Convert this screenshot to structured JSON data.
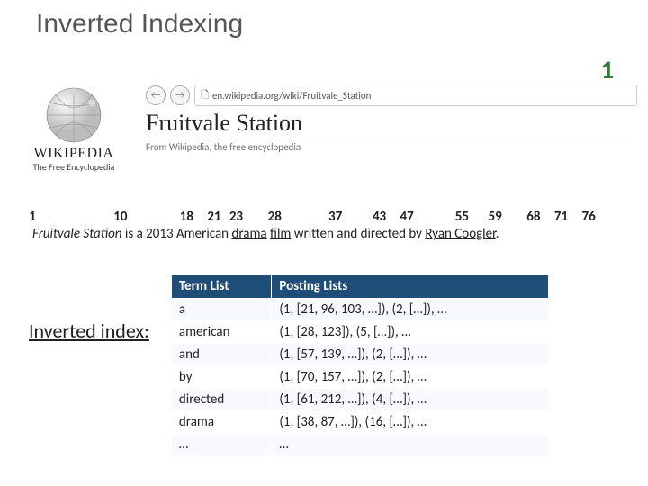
{
  "title": "Inverted Indexing",
  "page_number": "1",
  "wikipedia": {
    "wordmark": "WIKIPEDIA",
    "tagline": "The Free Encyclopedia"
  },
  "browser": {
    "url": "en.wikipedia.org/wiki/Fruitvale_Station"
  },
  "article": {
    "title": "Fruitvale Station",
    "subtitle": "From Wikipedia, the free encyclopedia"
  },
  "offsets": [
    "1",
    "10",
    "18",
    "21",
    "23",
    "28",
    "37",
    "43",
    "47",
    "55",
    "59",
    "68",
    "71",
    "76"
  ],
  "offset_positions_pct": [
    0,
    16,
    28,
    33,
    37,
    44,
    55,
    63,
    68,
    78,
    84,
    91,
    96,
    101
  ],
  "sentence": {
    "p1": "Fruitvale Station",
    "p2": " is a 2013 American ",
    "link1": "drama",
    "link2": "film",
    "p3": " written and directed by ",
    "link3": "Ryan Coogler",
    "fullstop": "."
  },
  "inverted_label": "Inverted index:",
  "table": {
    "headers": [
      "Term List",
      "Posting Lists"
    ],
    "rows": [
      {
        "term": "a",
        "posting": "(1, [21, 96, 103, …]), (2, […]), …"
      },
      {
        "term": "american",
        "posting": "(1, [28, 123]), (5, […]), …"
      },
      {
        "term": "and",
        "posting": "(1, [57, 139, …]), (2, […]), …"
      },
      {
        "term": "by",
        "posting": "(1, [70, 157, …]), (2, […]), …"
      },
      {
        "term": "directed",
        "posting": "(1, [61, 212, …]), (4, […]), …"
      },
      {
        "term": "drama",
        "posting": "(1, [38, 87, …]), (16, […]), …"
      },
      {
        "term": "…",
        "posting": "…"
      }
    ]
  }
}
